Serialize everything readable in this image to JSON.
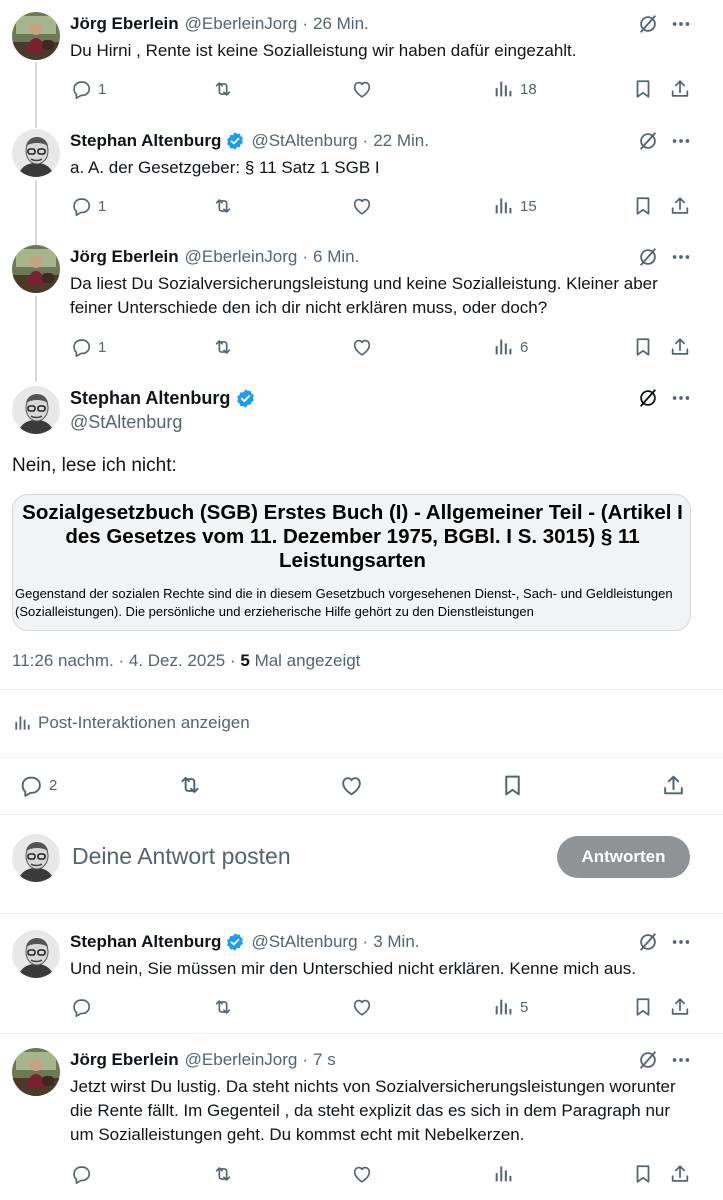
{
  "replies": [
    {
      "name": "Jörg Eberlein",
      "handle": "@EberleinJorg",
      "time": "26 Min.",
      "text": "Du Hirni , Rente ist keine Sozialleistung wir haben dafür eingezahlt.",
      "reply_count": "1",
      "views": "18"
    },
    {
      "name": "Stephan Altenburg",
      "handle": "@StAltenburg",
      "time": "22 Min.",
      "text": "a. A. der Gesetzgeber: § 11 Satz 1 SGB I",
      "reply_count": "1",
      "views": "15"
    },
    {
      "name": "Jörg Eberlein",
      "handle": "@EberleinJorg",
      "time": "6 Min.",
      "text": "Da liest Du Sozialversicherungsleistung und keine Sozialleistung. Kleiner aber feiner Unterschiede den ich dir nicht erklären muss, oder doch?",
      "reply_count": "1",
      "views": "6"
    }
  ],
  "main_post": {
    "name": "Stephan Altenburg",
    "handle": "@StAltenburg",
    "text": "Nein, lese ich nicht:",
    "card_title": "Sozialgesetzbuch (SGB) Erstes Buch (I) - Allgemeiner Teil - (Artikel I des Gesetzes vom 11. Dezember 1975, BGBl. I S. 3015) § 11 Leistungsarten",
    "card_body": "Gegenstand der sozialen Rechte sind die in diesem Gesetzbuch vorgesehenen Dienst-, Sach- und Geldleistungen (Sozialleistungen). Die persönliche und erzieherische Hilfe gehört zu den Dienstleistungen",
    "timestamp": "11:26 nachm. · 4. Dez. 2025 · ",
    "views_count": "5",
    "views_label": " Mal angezeigt",
    "interactions_label": "Post-Interaktionen anzeigen",
    "reply_count": "2"
  },
  "composer": {
    "placeholder": "Deine Antwort posten",
    "button_label": "Antworten"
  },
  "later_replies": [
    {
      "name": "Stephan Altenburg",
      "handle": "@StAltenburg",
      "time": "3 Min.",
      "text": "Und nein, Sie müssen mir den Unterschied nicht erklären. Kenne mich aus.",
      "views": "5"
    },
    {
      "name": "Jörg Eberlein",
      "handle": "@EberleinJorg",
      "time": "7 s",
      "text": "Jetzt wirst Du lustig. Da steht nichts von Sozialversicherungsleistungen worunter die Rente fällt. Im Gegenteil , da steht explizit das es sich in dem Paragraph nur um Sozialleistungen geht.  Du kommst echt mit Nebelkerzen."
    }
  ],
  "colors": {
    "verified": "#1d9bf0",
    "muted": "#536471",
    "button_disabled": "#8f9396"
  },
  "icons": [
    "reply-icon",
    "retweet-icon",
    "like-icon",
    "views-icon",
    "bookmark-icon",
    "share-icon",
    "grok-icon",
    "more-icon",
    "verified-badge-icon",
    "interactions-icon"
  ]
}
